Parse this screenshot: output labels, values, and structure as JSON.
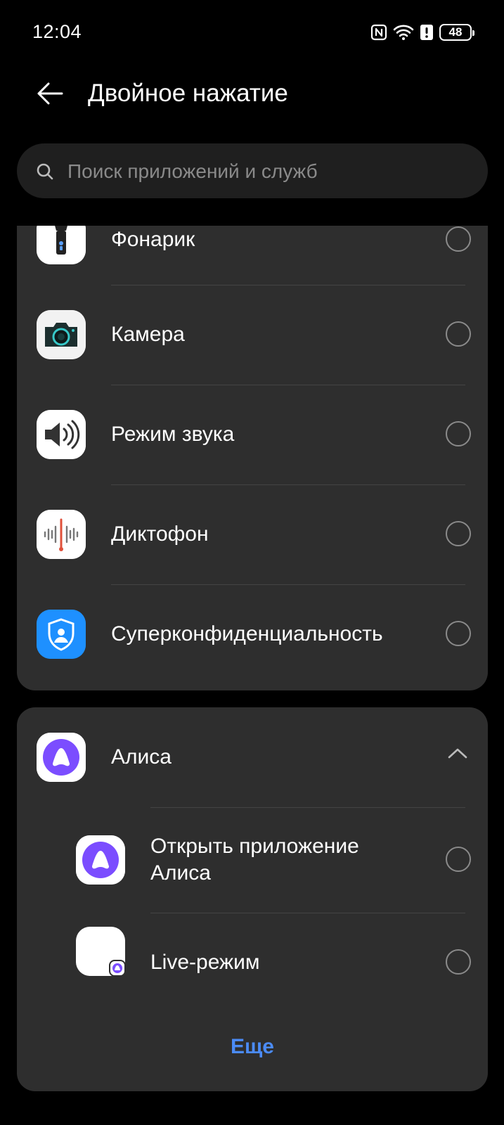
{
  "status": {
    "time": "12:04",
    "battery": "48"
  },
  "header": {
    "title": "Двойное нажатие"
  },
  "search": {
    "placeholder": "Поиск приложений и служб"
  },
  "list": {
    "items": [
      {
        "label": "Фонарик",
        "icon": "flashlight-icon"
      },
      {
        "label": "Камера",
        "icon": "camera-icon"
      },
      {
        "label": "Режим звука",
        "icon": "sound-mode-icon"
      },
      {
        "label": "Диктофон",
        "icon": "recorder-icon"
      },
      {
        "label": "Суперконфиденциальность",
        "icon": "privacy-shield-icon"
      }
    ]
  },
  "alice": {
    "label": "Алиса",
    "icon": "alice-icon",
    "sub_items": [
      {
        "label": "Открыть приложение Алиса",
        "icon": "alice-icon"
      },
      {
        "label": "Live-режим",
        "icon": "live-mode-icon"
      }
    ],
    "more_label": "Еще"
  },
  "colors": {
    "accent": "#4b8bf5",
    "card": "#2e2e2e",
    "background": "#000000",
    "privacy_blue": "#1e90ff",
    "alice_purple": "#7b4dff"
  }
}
